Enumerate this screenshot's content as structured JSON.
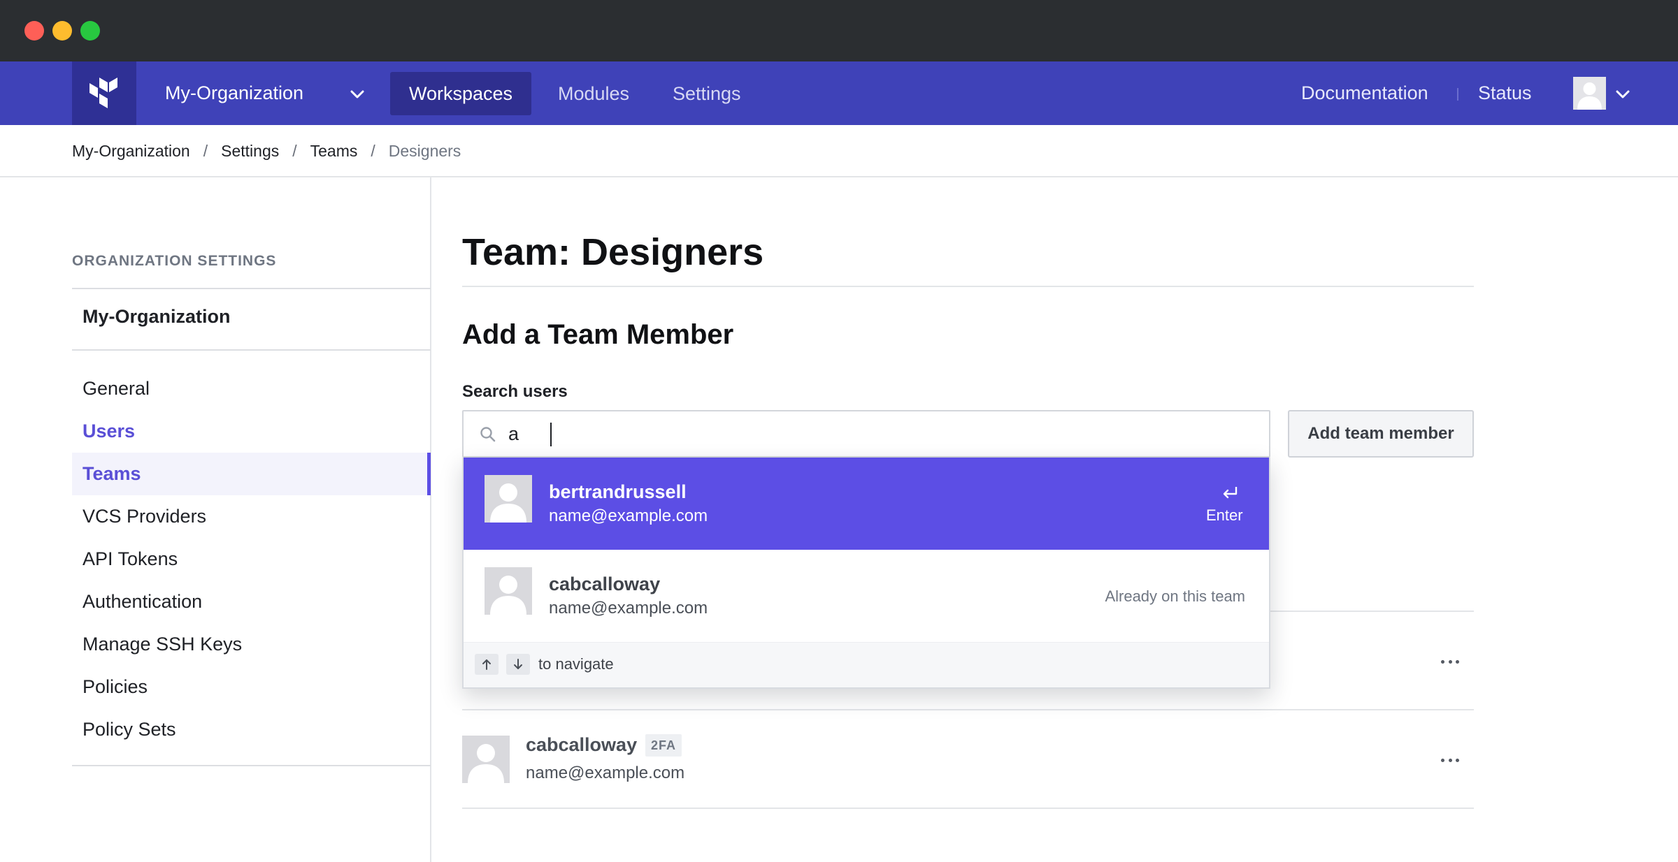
{
  "window": {
    "colors": {
      "close": "#fe5f57",
      "minimize": "#febc2e",
      "zoom": "#28c840"
    }
  },
  "nav": {
    "logo_icon": "terraform-logo-icon",
    "org_name": "My-Organization",
    "tabs": [
      {
        "label": "Workspaces",
        "active": true
      },
      {
        "label": "Modules",
        "active": false
      },
      {
        "label": "Settings",
        "active": false
      }
    ],
    "links": {
      "documentation": "Documentation",
      "status": "Status"
    },
    "avatar_icon": "user-avatar-icon",
    "colors": {
      "bar": "#3f42b8",
      "active_tab": "#2f2f8f",
      "logo_bg": "#2f3095"
    }
  },
  "breadcrumb": {
    "items": [
      "My-Organization",
      "Settings",
      "Teams",
      "Designers"
    ],
    "separator": "/"
  },
  "sidebar": {
    "heading": "ORGANIZATION SETTINGS",
    "org_name": "My-Organization",
    "items": [
      {
        "label": "General",
        "active": false
      },
      {
        "label": "Users",
        "active": false
      },
      {
        "label": "Teams",
        "active": true
      },
      {
        "label": "VCS Providers",
        "active": false
      },
      {
        "label": "API Tokens",
        "active": false
      },
      {
        "label": "Authentication",
        "active": false
      },
      {
        "label": "Manage SSH Keys",
        "active": false
      },
      {
        "label": "Policies",
        "active": false
      },
      {
        "label": "Policy Sets",
        "active": false
      }
    ],
    "colors": {
      "accent": "#5c4ee5"
    }
  },
  "main": {
    "page_title": "Team: Designers",
    "section_title": "Add a Team Member",
    "search": {
      "label": "Search users",
      "value": "a"
    },
    "add_button": "Add team member",
    "dropdown": {
      "results": [
        {
          "username": "bertrandrussell",
          "email": "name@example.com",
          "hint": "Enter",
          "highlighted": true
        },
        {
          "username": "cabcalloway",
          "email": "name@example.com",
          "note": "Already on this team",
          "highlighted": false
        }
      ],
      "footer_hint": "to navigate",
      "colors": {
        "highlight": "#5c4ee5"
      }
    },
    "members": [
      {
        "username": "cabcalloway",
        "badge": "2FA",
        "email": "name@example.com"
      }
    ]
  }
}
